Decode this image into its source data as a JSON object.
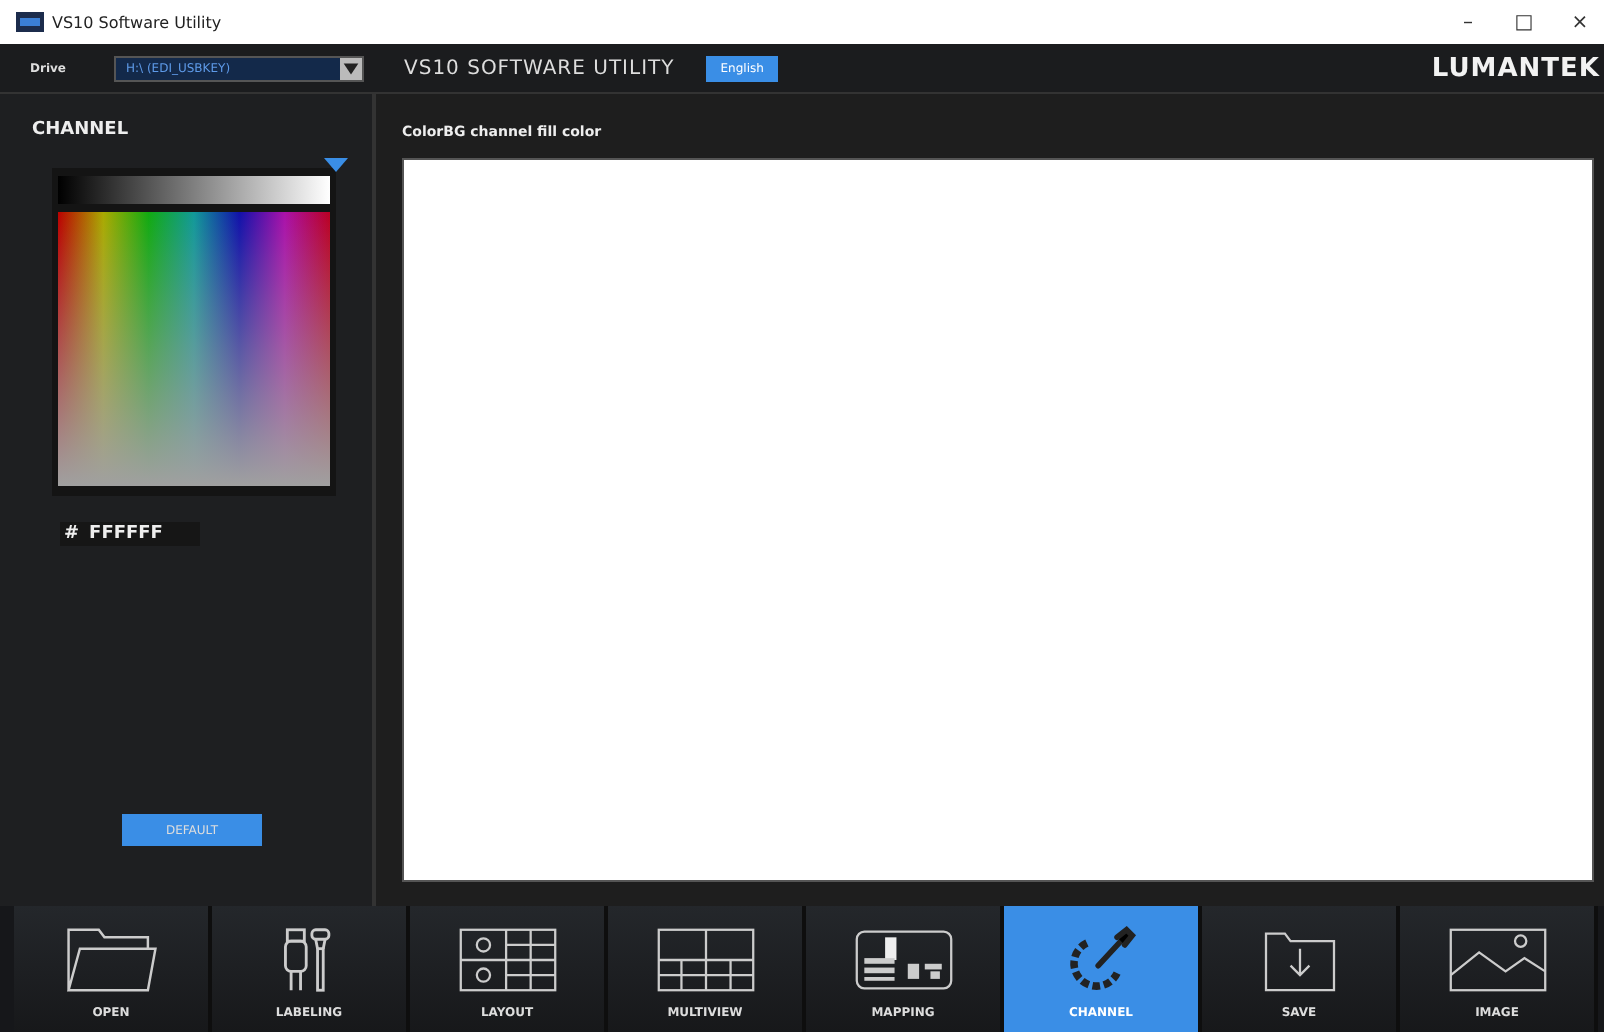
{
  "window": {
    "title": "VS10 Software Utility",
    "controls": [
      "–",
      "□",
      "×"
    ]
  },
  "header": {
    "drive_label": "Drive",
    "drive_value": "H:\\ (EDI_USBKEY)",
    "app_title": "VS10 SOFTWARE UTILITY",
    "language_button": "English",
    "logo": "LUMANTEK"
  },
  "sidebar": {
    "title": "CHANNEL",
    "hash": "#",
    "color_value": "FFFFFF",
    "default_button": "DEFAULT"
  },
  "content": {
    "title": "ColorBG channel fill color"
  },
  "tabs": [
    {
      "label": "OPEN",
      "kind": "open",
      "selected": false
    },
    {
      "label": "LABELING",
      "kind": "labeling",
      "selected": false
    },
    {
      "label": "LAYOUT",
      "kind": "layout",
      "selected": false
    },
    {
      "label": "MULTIVIEW",
      "kind": "multiview",
      "selected": false
    },
    {
      "label": "MAPPING",
      "kind": "mapping",
      "selected": false
    },
    {
      "label": "CHANNEL",
      "kind": "channel",
      "selected": true
    },
    {
      "label": "SAVE",
      "kind": "save",
      "selected": false
    },
    {
      "label": "IMAGE",
      "kind": "image",
      "selected": false
    }
  ]
}
